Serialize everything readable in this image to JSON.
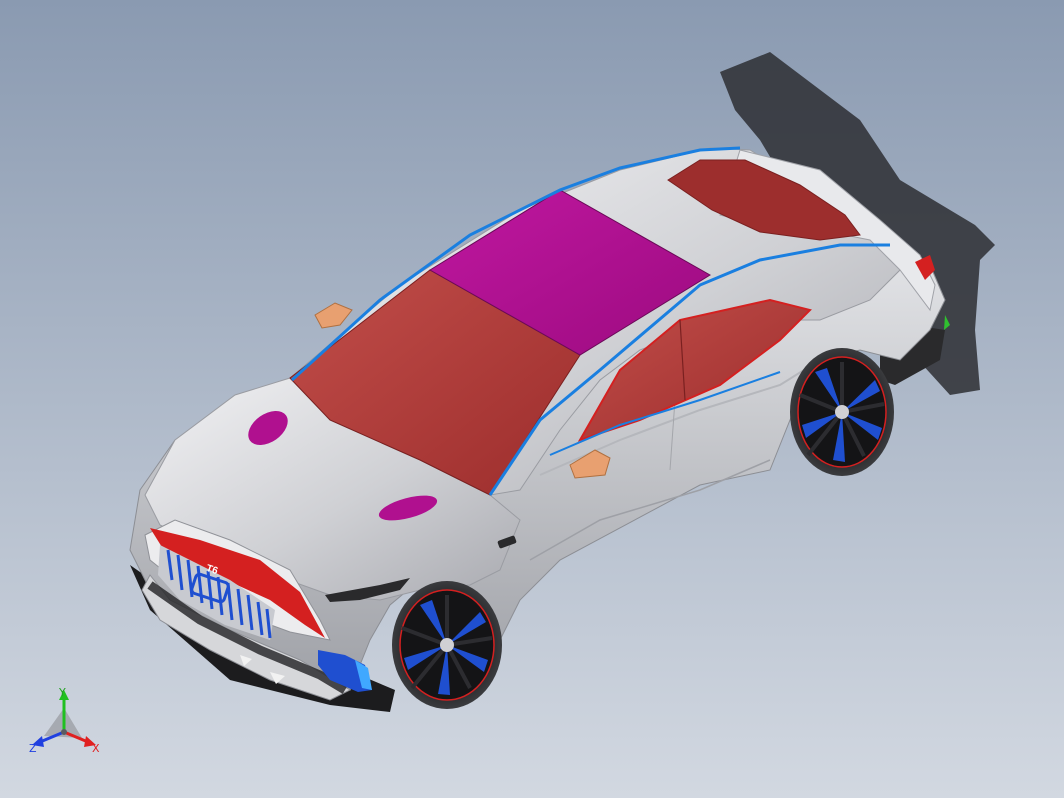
{
  "viewport": {
    "background_top": "#8d9db3",
    "background_bottom": "#cfd5df"
  },
  "model": {
    "grille_badge": "T6",
    "body_color": "#d8d9dc",
    "glass_color": "#b8403e",
    "sunroof_color": "#b0108f",
    "accent_blue": "#1a7fe0",
    "accent_red": "#d42020",
    "mirror_color": "#e8a070"
  },
  "triad": {
    "x_label": "X",
    "y_label": "Y",
    "z_label": "Z",
    "x_color": "#e02020",
    "y_color": "#20c020",
    "z_color": "#2040e0"
  }
}
